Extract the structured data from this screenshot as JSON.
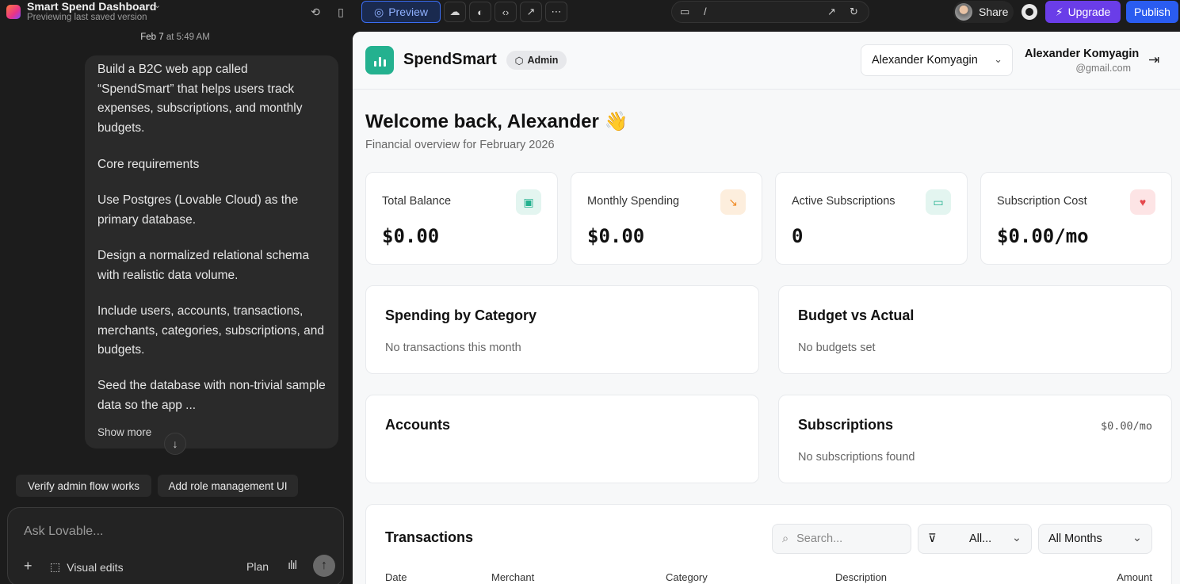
{
  "topbar": {
    "project_title": "Smart Spend Dashboard",
    "project_subtitle": "Previewing last saved version",
    "preview_label": "Preview",
    "url_path": "/",
    "share_label": "Share",
    "upgrade_label": "Upgrade",
    "publish_label": "Publish"
  },
  "chat": {
    "timestamp_date": "Feb 7",
    "timestamp_time": "at 5:49 AM",
    "paragraphs": [
      "Build a B2C web app called “SpendSmart” that helps users track expenses, subscriptions, and monthly budgets.",
      "Core requirements",
      "Use Postgres (Lovable Cloud) as the primary database.",
      "Design a normalized relational schema with realistic data volume.",
      "Include users, accounts, transactions, merchants, categories, subscriptions, and budgets.",
      "Seed the database with non-trivial sample data so the app ..."
    ],
    "show_more": "Show more",
    "suggestions": [
      "Verify admin flow works",
      "Add role management UI"
    ],
    "composer_placeholder": "Ask Lovable...",
    "visual_edits": "Visual edits",
    "plan": "Plan"
  },
  "app": {
    "name": "SpendSmart",
    "badge": "Admin",
    "user_select": "Alexander Komyagin",
    "user_name": "Alexander Komyagin",
    "user_email": "@gmail.com",
    "welcome": "Welcome back, Alexander 👋",
    "welcome_sub": "Financial overview for February 2026",
    "stats": [
      {
        "label": "Total Balance",
        "value": "$0.00",
        "icon": "wallet-icon",
        "color": "#24b18f"
      },
      {
        "label": "Monthly Spending",
        "value": "$0.00",
        "icon": "trending-down-icon",
        "color": "#f08a24"
      },
      {
        "label": "Active Subscriptions",
        "value": "0",
        "icon": "credit-card-icon",
        "color": "#24b18f"
      },
      {
        "label": "Subscription Cost",
        "value": "$0.00/mo",
        "icon": "piggy-bank-icon",
        "color": "#e5484d"
      }
    ],
    "spending": {
      "title": "Spending by Category",
      "empty": "No transactions this month"
    },
    "budget": {
      "title": "Budget vs Actual",
      "empty": "No budgets set"
    },
    "accounts": {
      "title": "Accounts"
    },
    "subscriptions": {
      "title": "Subscriptions",
      "cost": "$0.00/mo",
      "empty": "No subscriptions found"
    },
    "transactions": {
      "title": "Transactions",
      "search_placeholder": "Search...",
      "filter_value": "All...",
      "months_value": "All Months",
      "columns": [
        "Date",
        "Merchant",
        "Category",
        "Description",
        "Amount"
      ]
    }
  },
  "colors": {
    "accent": "#24b18f",
    "upgrade": "#6a3de8",
    "publish": "#2a5cf0",
    "preview_border": "#3b6ef5"
  }
}
